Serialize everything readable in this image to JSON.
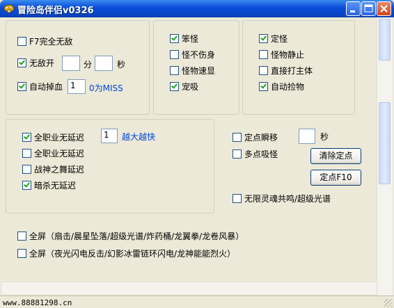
{
  "window": {
    "title": "冒险岛伴侣v0326",
    "status_text": "www.88881298.cn"
  },
  "group1": {
    "f7_label": "F7完全无敌",
    "invincible_label": "无敌开",
    "invincible_min_unit": "分",
    "invincible_sec_unit": "秒",
    "invincible_min_value": "",
    "invincible_sec_value": "",
    "auto_drop_label": "自动掉血",
    "auto_drop_value": "1",
    "auto_drop_hint": "0为MISS"
  },
  "group2": {
    "items": [
      "笨怪",
      "怪不伤身",
      "怪物速显",
      "宠吸"
    ]
  },
  "group3": {
    "items": [
      "定怪",
      "怪物静止",
      "直接打主体",
      "自动捡物"
    ]
  },
  "group4": {
    "items": [
      "全职业无延迟",
      "全职业无延迟",
      "战神之舞延迟",
      "暗杀无延迟"
    ],
    "delay_value": "1",
    "delay_hint": "越大越快"
  },
  "right_panel": {
    "fixed_teleport_label": "定点瞬移",
    "teleport_sec_value": "",
    "teleport_sec_unit": "秒",
    "multi_point_label": "多点吸怪",
    "clear_points_button": "清除定点",
    "fix_point_button": "定点F10",
    "unlimited_label": "无限灵魂共鸣/超级光谱"
  },
  "fullscreen": {
    "row1": "全屏（扇击/晨星坠落/超级光谱/炸药桶/龙翼拳/龙卷风暴）",
    "row2": "全屏（夜光闪电反击/幻影冰雷链环闪电/龙神能能烈火）"
  }
}
